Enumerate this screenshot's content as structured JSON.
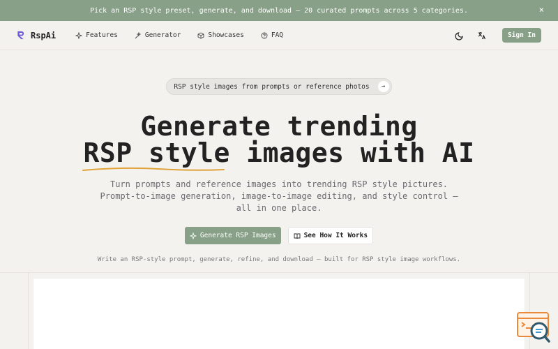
{
  "banner": {
    "text": "Pick an RSP style preset, generate, and download — 20 curated prompts across 5 categories.",
    "close_label": "×"
  },
  "nav": {
    "brand": "RspAi",
    "links": [
      {
        "label": "Features",
        "icon": "sparkles-icon"
      },
      {
        "label": "Generator",
        "icon": "wand-icon"
      },
      {
        "label": "Showcases",
        "icon": "cube-icon"
      },
      {
        "label": "FAQ",
        "icon": "help-circle-icon"
      }
    ],
    "signin_label": "Sign In"
  },
  "hero": {
    "pill_text": "RSP style images from prompts or reference photos",
    "pill_arrow": "→",
    "headline_line1": "Generate trending",
    "headline_accent": "RSP style",
    "headline_rest": " images with AI",
    "subtitle": "Turn prompts and reference images into trending RSP style pictures. Prompt-to-image generation, image-to-image editing, and style control — all in one place.",
    "primary_cta": "Generate RSP Images",
    "secondary_cta": "See How It Works",
    "note": "Write an RSP-style prompt, generate, refine, and download — built for RSP style image workflows."
  },
  "colors": {
    "accent": "#87a087",
    "logo": "#6b5bd6",
    "underline": "#e0a33a",
    "background": "#f4f2ef"
  }
}
